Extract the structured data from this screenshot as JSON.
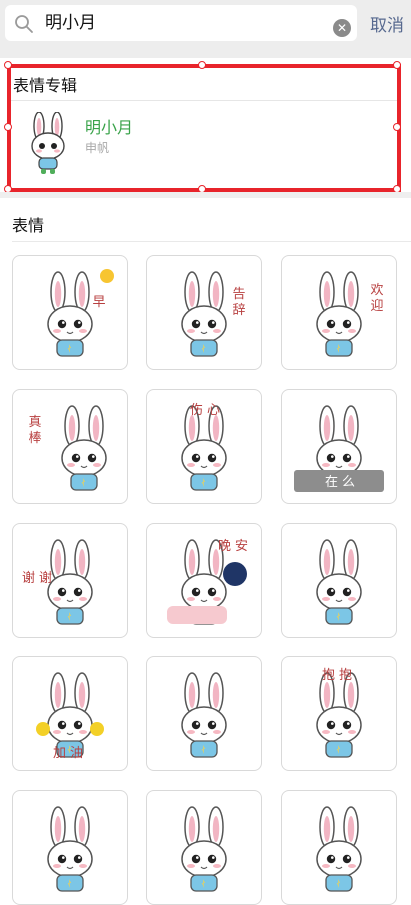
{
  "search": {
    "query": "明小月"
  },
  "actions": {
    "cancel_label": "取消"
  },
  "album_section": {
    "title": "表情专辑",
    "album": {
      "name": "明小月",
      "author": "申帆"
    }
  },
  "stickers_section": {
    "title": "表情",
    "items": [
      {
        "caption": "早"
      },
      {
        "caption": "告辞"
      },
      {
        "caption": "欢迎"
      },
      {
        "caption": "真棒"
      },
      {
        "caption": "伤心"
      },
      {
        "caption": "在么"
      },
      {
        "caption": "谢谢"
      },
      {
        "caption": "晚安"
      },
      {
        "caption": ""
      },
      {
        "caption": "加油"
      },
      {
        "caption": ""
      },
      {
        "caption": "抱抱"
      },
      {
        "caption": ""
      },
      {
        "caption": ""
      },
      {
        "caption": ""
      }
    ]
  },
  "colors": {
    "accent_green": "#3aa34a",
    "link_blue": "#57698f",
    "highlight_red": "#e8242b",
    "caption_red": "#b84040",
    "bunny_shirt": "#7cc6e6"
  }
}
